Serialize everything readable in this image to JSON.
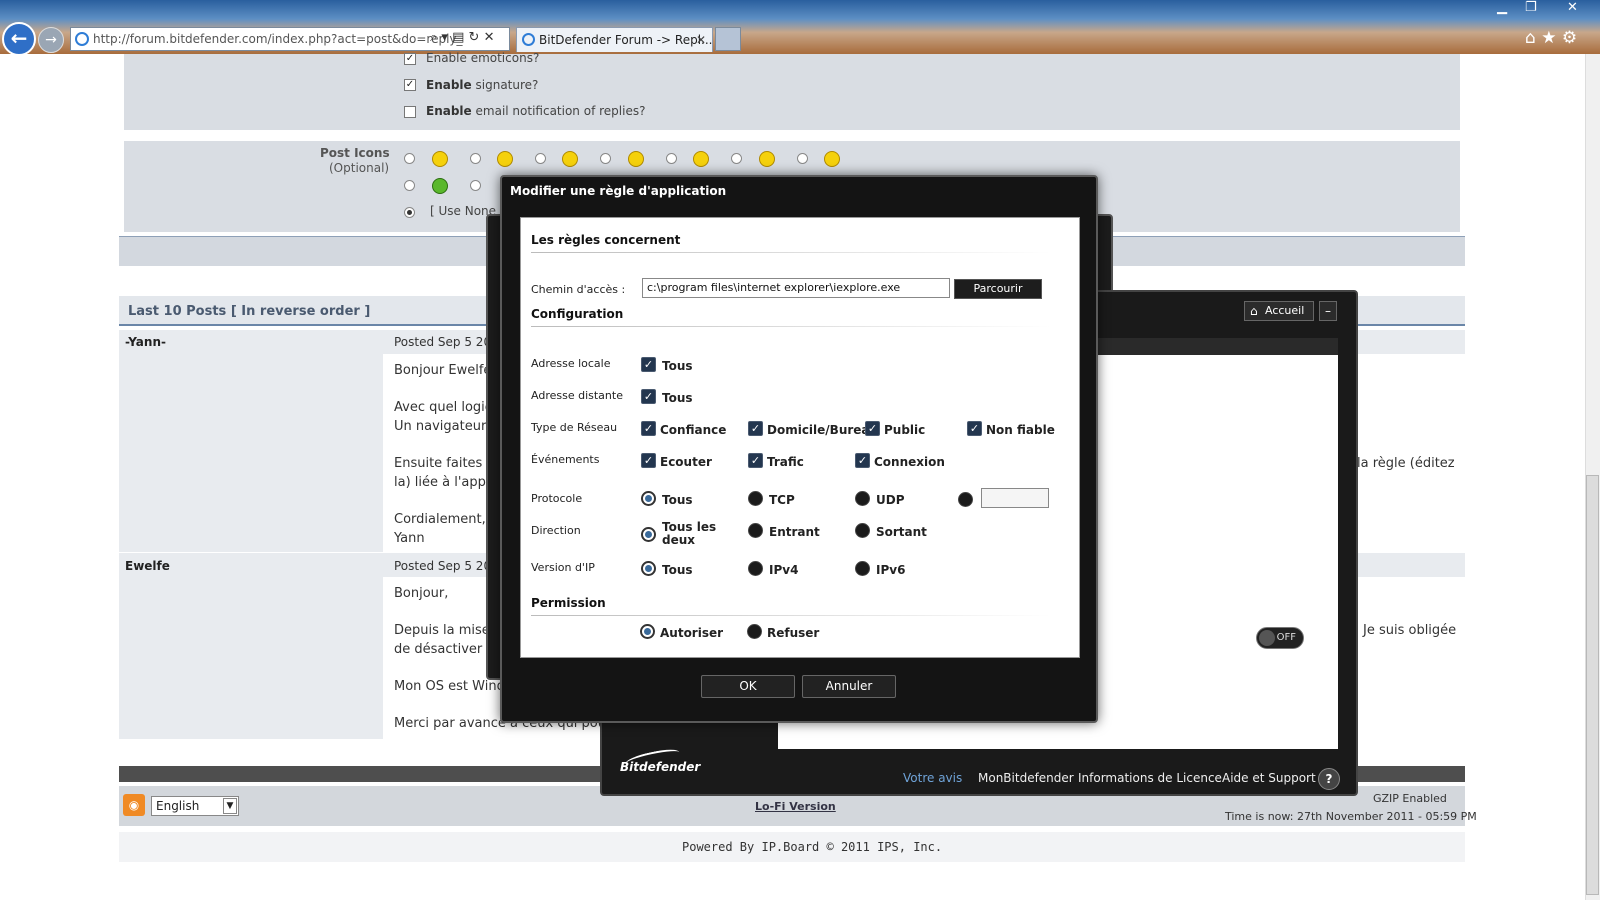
{
  "browser": {
    "url": "http://forum.bitdefender.com/index.php?act=post&do=reply_",
    "tab_title": "BitDefender Forum -> Repl...",
    "tab_close": "✕"
  },
  "forum": {
    "options": {
      "emoticons": "Enable emoticons?",
      "signature_bold": "Enable",
      "signature_rest": "signature?",
      "email_bold": "Enable",
      "email_rest": "email notification of replies?"
    },
    "post_icons": {
      "label": "Post Icons",
      "optional": "(Optional)",
      "use_none": "[ Use None ]"
    },
    "last10_title": "Last 10 Posts [ In reverse order ]",
    "posts": [
      {
        "author": "-Yann-",
        "date": "Posted Sep 5 20",
        "lines": [
          "Bonjour Ewelfe",
          "Avec quel logic",
          "Un navigateur,",
          "Ensuite faites n",
          "la) liée à l'appli",
          "Cordialement,",
          "Yann"
        ],
        "right_text": "la règle (éditez"
      },
      {
        "author": "Ewelfe",
        "date": "Posted Sep 5 20",
        "lines": [
          "Bonjour,",
          "Depuis la mise",
          "de désactiver le",
          "Mon OS est Wind",
          "Merci par avance à ceux qui pourr"
        ],
        "right_text": "Je suis obligée"
      }
    ],
    "language": "English",
    "lofi": "Lo-Fi Version",
    "gzip": "GZIP Enabled",
    "time_now": "Time is now: 27th November 2011 - 05:59 PM",
    "powered_by": "Powered By IP.Board © 2011  IPS, Inc."
  },
  "bitdefender": {
    "accueil": "Accueil",
    "toggle": "OFF",
    "logo": "Bitdefender",
    "footer_links": [
      "Votre avis",
      "MonBitdefender",
      "Informations de Licence",
      "Aide et Support"
    ],
    "help": "?"
  },
  "dialog": {
    "title": "Modifier une règle d'application",
    "sections": {
      "rules": "Les règles concernent",
      "config": "Configuration",
      "permission": "Permission"
    },
    "path_label": "Chemin d'accès :",
    "path_value": "c:\\program files\\internet explorer\\iexplore.exe",
    "browse": "Parcourir",
    "rows": {
      "local_addr": "Adresse locale",
      "remote_addr": "Adresse distante",
      "network_type": "Type de Réseau",
      "events": "Événements",
      "protocol": "Protocole",
      "direction": "Direction",
      "ip_version": "Version d'IP"
    },
    "local_all": "Tous",
    "remote_all": "Tous",
    "network": [
      "Confiance",
      "Domicile/Bureau",
      "Public",
      "Non fiable"
    ],
    "events": [
      "Ecouter",
      "Trafic",
      "Connexion"
    ],
    "protocol": [
      "Tous",
      "TCP",
      "UDP"
    ],
    "direction": [
      "Tous les deux",
      "Entrant",
      "Sortant"
    ],
    "ipversion": [
      "Tous",
      "IPv4",
      "IPv6"
    ],
    "permission": [
      "Autoriser",
      "Refuser"
    ],
    "ok": "OK",
    "cancel": "Annuler"
  },
  "colors": {
    "accent": "#23364f",
    "dialog_bg": "#141414"
  }
}
